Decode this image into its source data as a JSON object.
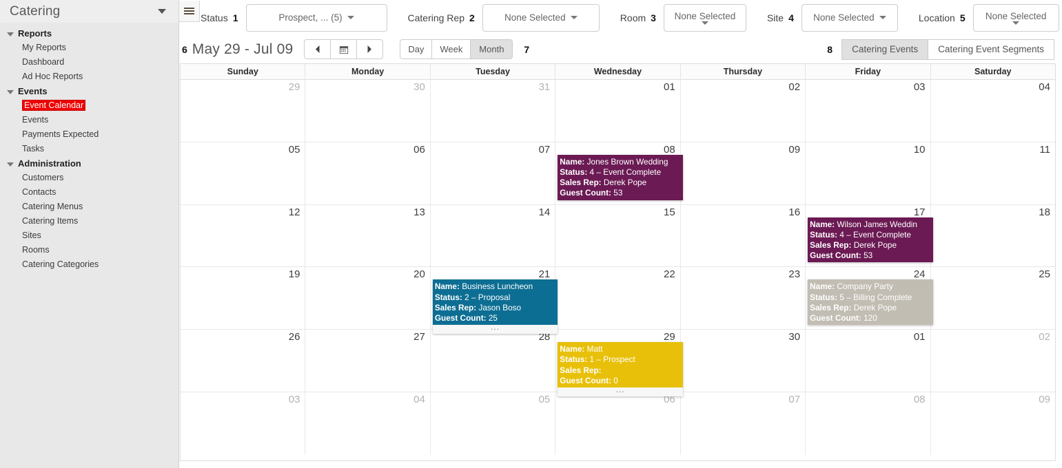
{
  "sidebar": {
    "title": "Catering",
    "caret_icon": "chevron-down-icon",
    "menu_icon": "hamburger-icon",
    "groups": [
      {
        "label": "Reports",
        "items": [
          {
            "label": "My Reports",
            "selected": false
          },
          {
            "label": "Dashboard",
            "selected": false
          },
          {
            "label": "Ad Hoc Reports",
            "selected": false
          }
        ]
      },
      {
        "label": "Events",
        "items": [
          {
            "label": "Event Calendar",
            "selected": true
          },
          {
            "label": "Events",
            "selected": false
          },
          {
            "label": "Payments Expected",
            "selected": false
          },
          {
            "label": "Tasks",
            "selected": false
          }
        ]
      },
      {
        "label": "Administration",
        "items": [
          {
            "label": "Customers",
            "selected": false
          },
          {
            "label": "Contacts",
            "selected": false
          },
          {
            "label": "Catering Menus",
            "selected": false
          },
          {
            "label": "Catering Items",
            "selected": false
          },
          {
            "label": "Sites",
            "selected": false
          },
          {
            "label": "Rooms",
            "selected": false
          },
          {
            "label": "Catering Categories",
            "selected": false
          }
        ]
      }
    ]
  },
  "filterbar": {
    "status": {
      "label": "Status",
      "number": "1",
      "value": "Prospect, ... (5)"
    },
    "catering_rep": {
      "label": "Catering Rep",
      "number": "2",
      "value": "None Selected"
    },
    "room": {
      "label": "Room",
      "number": "3",
      "value": "None Selected"
    },
    "site": {
      "label": "Site",
      "number": "4",
      "value": "None Selected"
    },
    "location": {
      "label": "Location",
      "number": "5",
      "value": "None Selected"
    },
    "refresh_icon": "refresh-icon"
  },
  "toolbar": {
    "range_number": "6",
    "range_title": "May 29 - Jul 09",
    "prev_icon": "chevron-left-icon",
    "calendar_icon": "calendar-icon",
    "next_icon": "chevron-right-icon",
    "view_day": "Day",
    "view_week": "Week",
    "view_month": "Month",
    "view_active": "Month",
    "view_number": "7",
    "tabs_number": "8",
    "tab_events": "Catering Events",
    "tab_segments": "Catering Event Segments",
    "tab_active": "Catering Events"
  },
  "calendar": {
    "day_headers": [
      "Sunday",
      "Monday",
      "Tuesday",
      "Wednesday",
      "Thursday",
      "Friday",
      "Saturday"
    ],
    "weeks": [
      [
        {
          "num": "29",
          "muted": true
        },
        {
          "num": "30",
          "muted": true
        },
        {
          "num": "31",
          "muted": true
        },
        {
          "num": "01",
          "muted": false
        },
        {
          "num": "02",
          "muted": false
        },
        {
          "num": "03",
          "muted": false
        },
        {
          "num": "04",
          "muted": false
        }
      ],
      [
        {
          "num": "05",
          "muted": false
        },
        {
          "num": "06",
          "muted": false
        },
        {
          "num": "07",
          "muted": false
        },
        {
          "num": "08",
          "muted": false
        },
        {
          "num": "09",
          "muted": false
        },
        {
          "num": "10",
          "muted": false
        },
        {
          "num": "11",
          "muted": false
        }
      ],
      [
        {
          "num": "12",
          "muted": false
        },
        {
          "num": "13",
          "muted": false
        },
        {
          "num": "14",
          "muted": false
        },
        {
          "num": "15",
          "muted": false
        },
        {
          "num": "16",
          "muted": false
        },
        {
          "num": "17",
          "muted": false
        },
        {
          "num": "18",
          "muted": false
        }
      ],
      [
        {
          "num": "19",
          "muted": false
        },
        {
          "num": "20",
          "muted": false
        },
        {
          "num": "21",
          "muted": false
        },
        {
          "num": "22",
          "muted": false
        },
        {
          "num": "23",
          "muted": false
        },
        {
          "num": "24",
          "muted": false
        },
        {
          "num": "25",
          "muted": false
        }
      ],
      [
        {
          "num": "26",
          "muted": false
        },
        {
          "num": "27",
          "muted": false
        },
        {
          "num": "28",
          "muted": false
        },
        {
          "num": "29",
          "muted": false
        },
        {
          "num": "30",
          "muted": false
        },
        {
          "num": "01",
          "muted": false
        },
        {
          "num": "02",
          "muted": true
        }
      ],
      [
        {
          "num": "03",
          "muted": true
        },
        {
          "num": "04",
          "muted": true
        },
        {
          "num": "05",
          "muted": true
        },
        {
          "num": "06",
          "muted": true
        },
        {
          "num": "07",
          "muted": true
        },
        {
          "num": "08",
          "muted": true
        },
        {
          "num": "09",
          "muted": true
        }
      ]
    ],
    "field_labels": {
      "name": "Name:",
      "status": "Status:",
      "sales_rep": "Sales Rep:",
      "guest_count": "Guest Count:"
    },
    "more_indicator": "...",
    "events": [
      {
        "id": "jones-brown-wedding",
        "name": "Jones Brown Wedding",
        "status": "4 – Event Complete",
        "sales_rep": "Derek Pope",
        "guest_count": "53",
        "color": "#6b1a54",
        "week": 1,
        "day": 3,
        "has_more": false
      },
      {
        "id": "wilson-james-wedding",
        "name": "Wilson James Weddin",
        "status": "4 – Event Complete",
        "sales_rep": "Derek Pope",
        "guest_count": "53",
        "color": "#6b1a54",
        "week": 2,
        "day": 5,
        "has_more": false
      },
      {
        "id": "business-luncheon",
        "name": "Business Luncheon",
        "status": "2 – Proposal",
        "sales_rep": "Jason Boso",
        "guest_count": "25",
        "color": "#0d6e93",
        "week": 3,
        "day": 2,
        "has_more": true
      },
      {
        "id": "company-party",
        "name": "Company Party",
        "status": "5 – Billing Complete",
        "sales_rep": "Derek Pope",
        "guest_count": "120",
        "color": "#c2bdb3",
        "week": 3,
        "day": 5,
        "has_more": false
      },
      {
        "id": "matt",
        "name": "Matt",
        "status": "1 – Prospect",
        "sales_rep": "",
        "guest_count": "0",
        "color": "#e8c00a",
        "week": 4,
        "day": 3,
        "has_more": true
      }
    ]
  }
}
